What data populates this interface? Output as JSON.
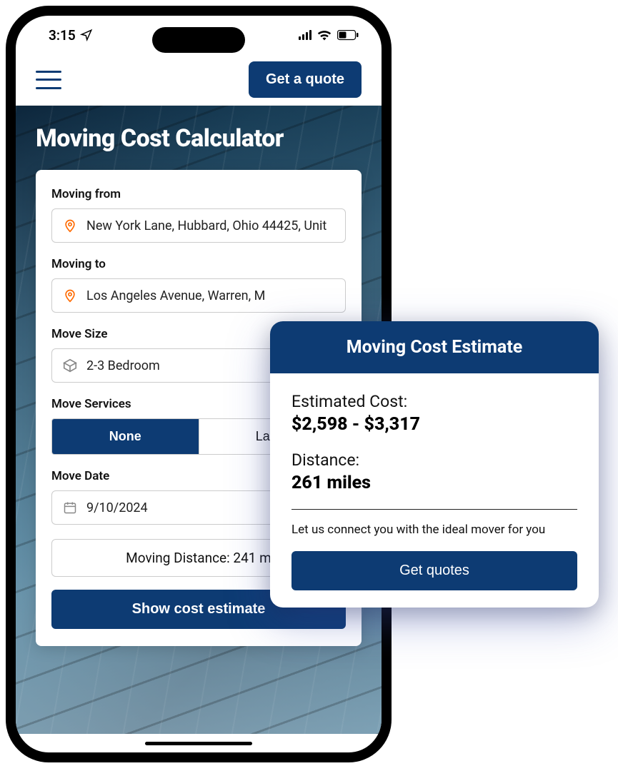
{
  "status": {
    "time": "3:15"
  },
  "nav": {
    "quote_button": "Get a quote"
  },
  "hero": {
    "title": "Moving Cost Calculator"
  },
  "form": {
    "from_label": "Moving from",
    "from_value": "New York Lane, Hubbard, Ohio 44425, Unit",
    "to_label": "Moving to",
    "to_value": "Los Angeles Avenue, Warren, M",
    "size_label": "Move Size",
    "size_value": "2-3 Bedroom",
    "services_label": "Move Services",
    "services_options": [
      "None",
      "Labor"
    ],
    "services_selected": "None",
    "date_label": "Move Date",
    "date_value": "9/10/2024",
    "distance_text": "Moving Distance: 241 m",
    "submit_label": "Show cost estimate"
  },
  "estimate": {
    "header": "Moving Cost Estimate",
    "cost_label": "Estimated Cost:",
    "cost_value": "$2,598 - $3,317",
    "distance_label": "Distance:",
    "distance_value": "261 miles",
    "note": "Let us connect you with the ideal mover for you",
    "button": "Get quotes"
  }
}
